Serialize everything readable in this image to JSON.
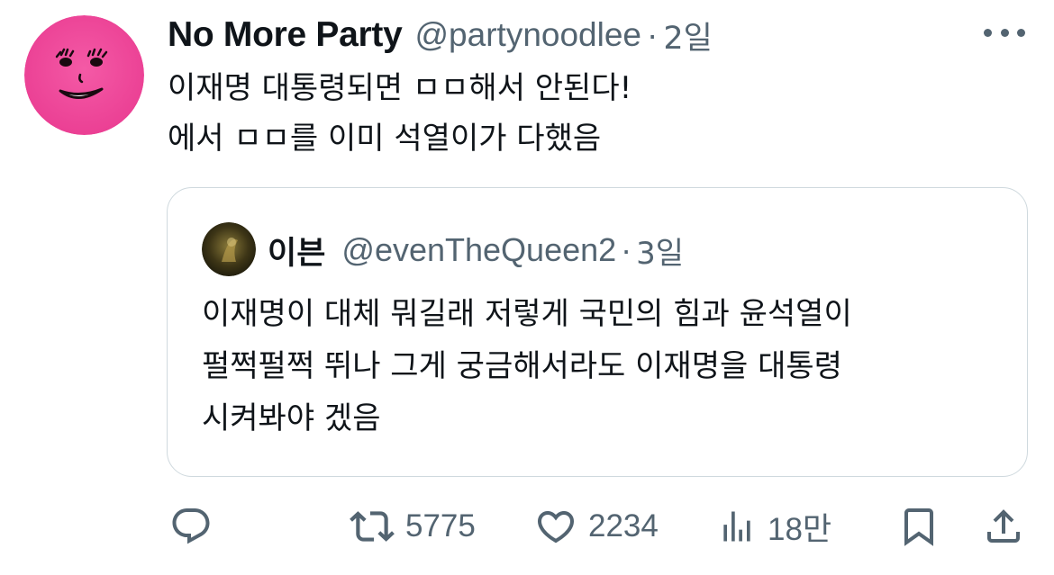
{
  "author": {
    "display_name": "No More Party",
    "handle": "@partynoodlee",
    "separator": "·",
    "time": "2일",
    "avatar_icon": "pink-smiley-face-avatar"
  },
  "tweet": {
    "lines": [
      "이재명 대통령되면 ㅁㅁ해서 안된다!",
      "에서 ㅁㅁ를 이미 석열이가 다했음"
    ]
  },
  "quote": {
    "display_name": "이븐",
    "handle": "@evenTheQueen2",
    "separator": "·",
    "time": "3일",
    "avatar_icon": "dark-gold-avatar",
    "lines": [
      "이재명이 대체 뭐길래 저렇게 국민의 힘과 윤석열이",
      "펄쩍펄쩍 뛰나 그게 궁금해서라도 이재명을 대통령",
      "시켜봐야 겠음"
    ]
  },
  "actions": {
    "reply": {
      "icon": "reply-icon",
      "count": ""
    },
    "retweet": {
      "icon": "retweet-icon",
      "count": "5775"
    },
    "like": {
      "icon": "heart-icon",
      "count": "2234"
    },
    "views": {
      "icon": "views-chart-icon",
      "count": "18만"
    },
    "bookmark": {
      "icon": "bookmark-icon"
    },
    "share": {
      "icon": "share-icon"
    }
  },
  "colors": {
    "text": "#0f1419",
    "secondary": "#536471",
    "border": "#cfd9de",
    "avatar_pink": "#f0479a"
  }
}
